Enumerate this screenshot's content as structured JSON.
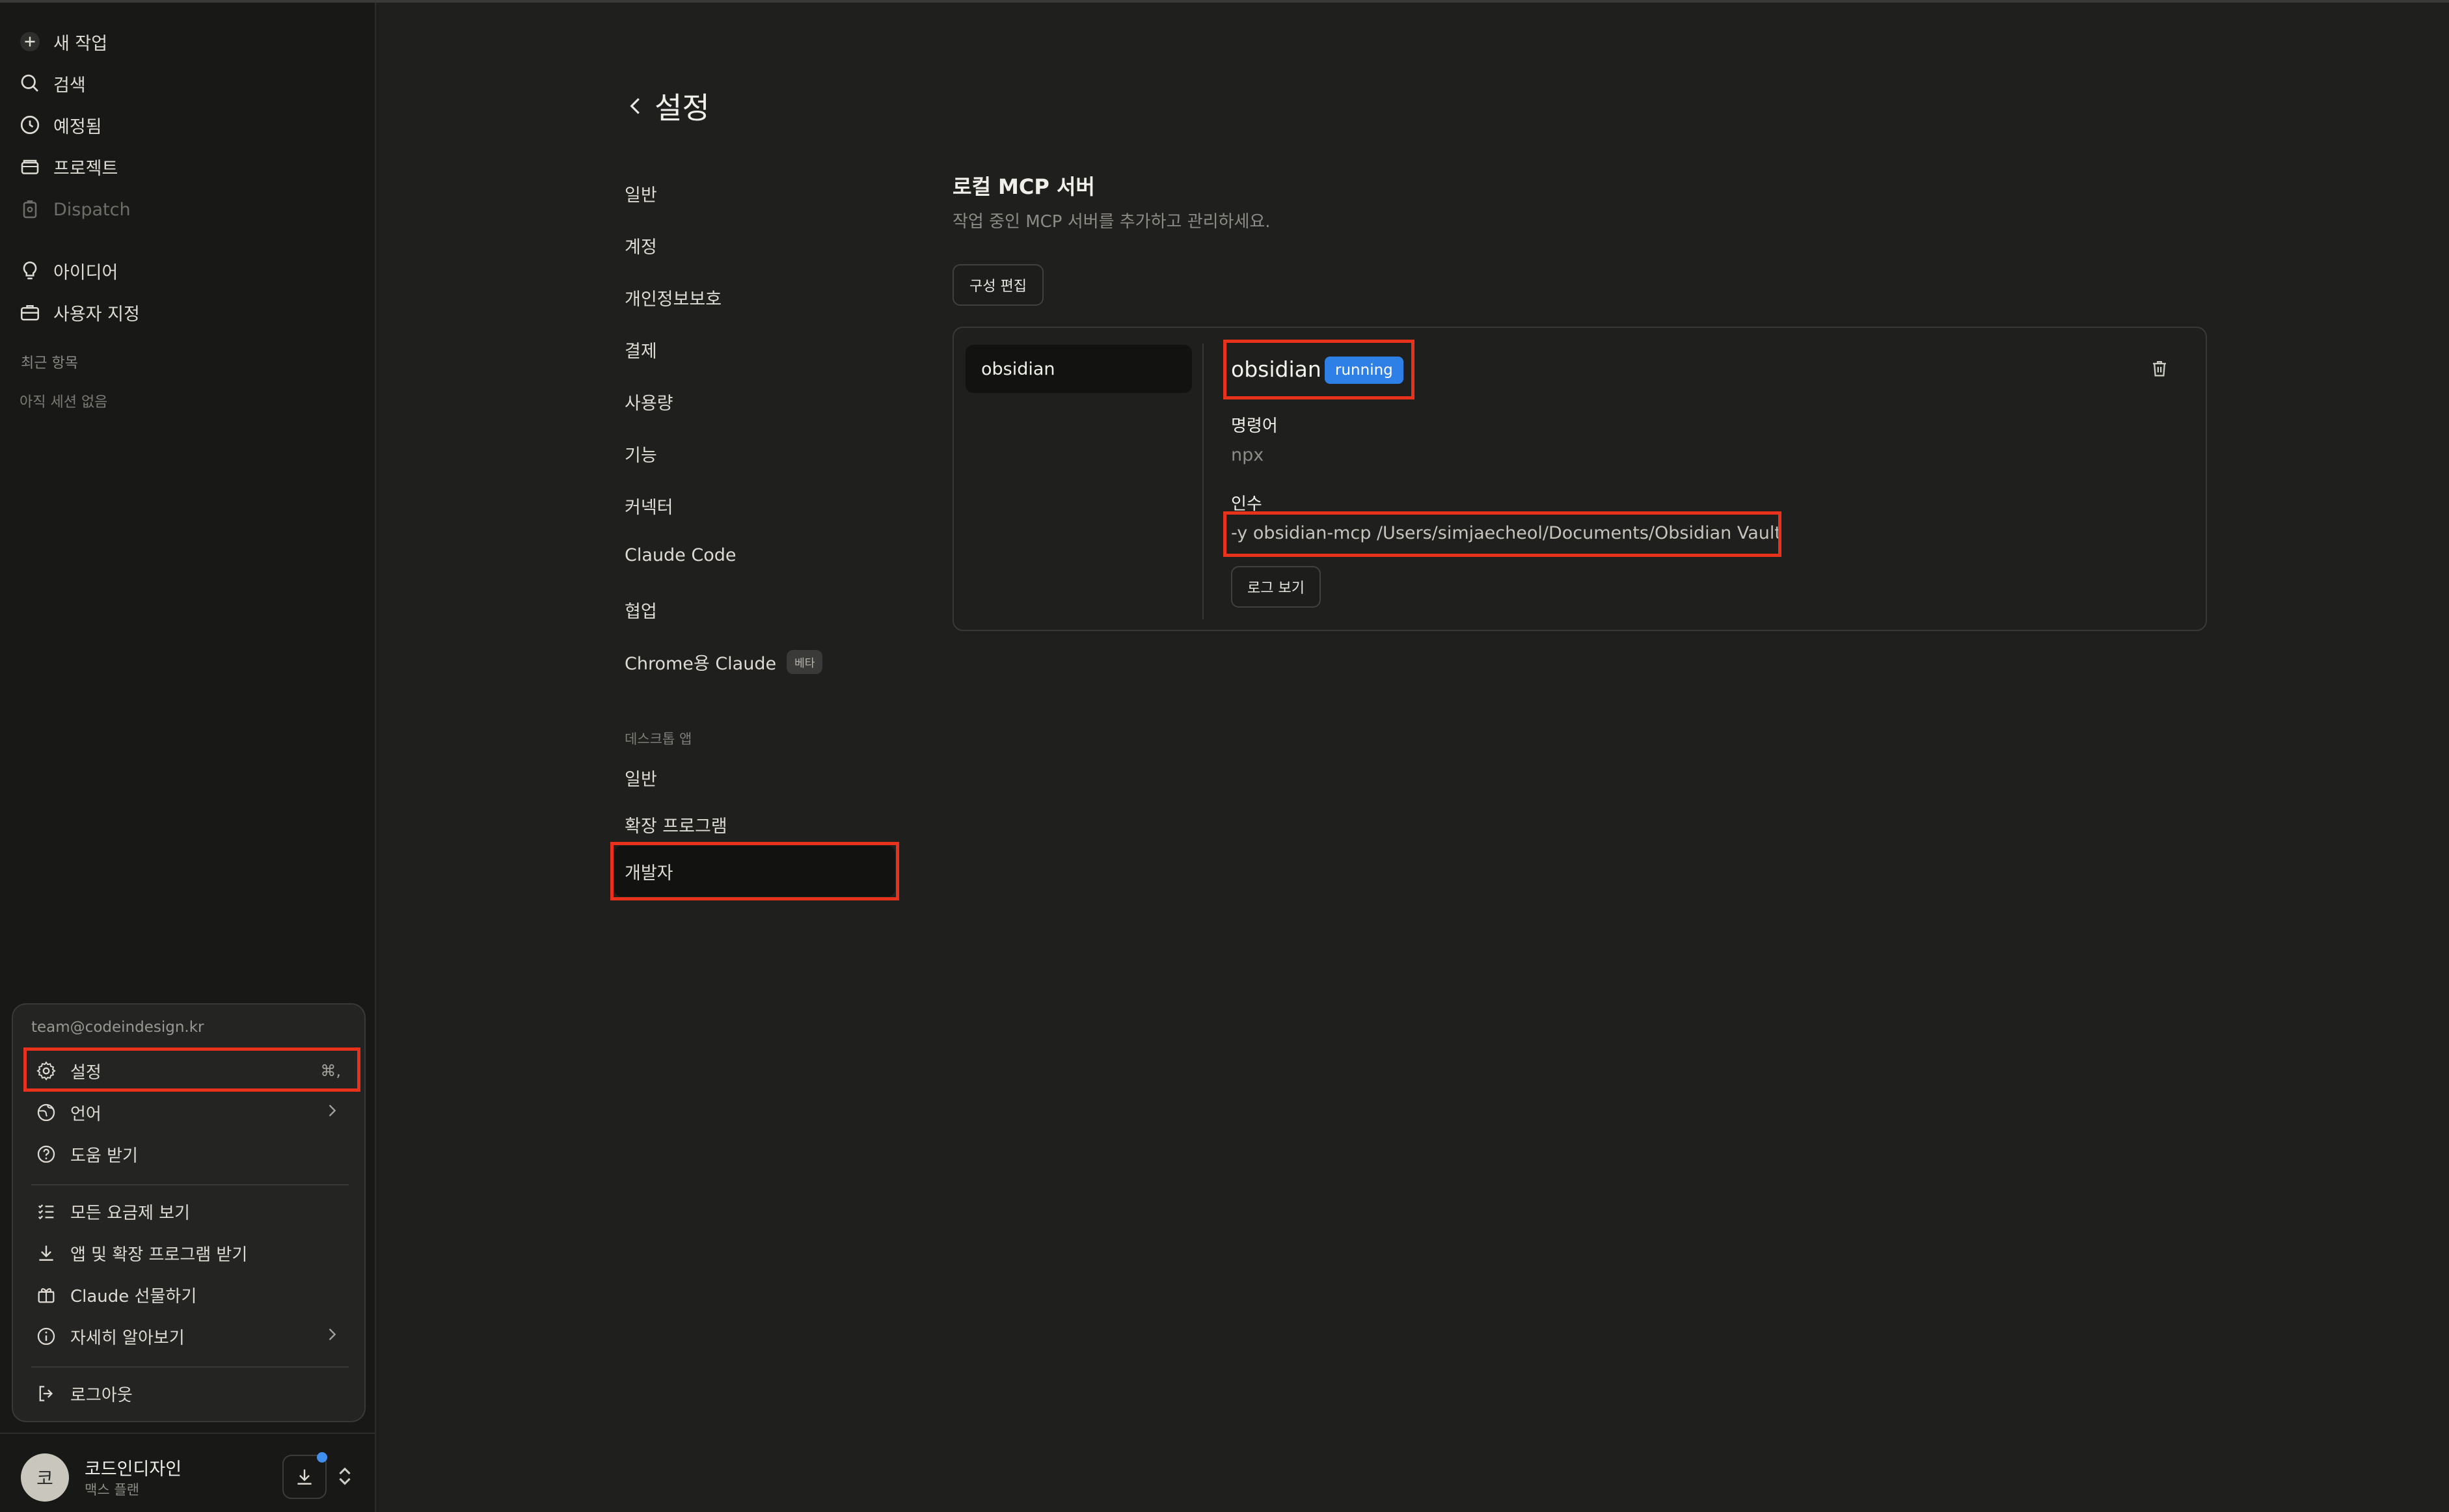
{
  "sidebar": {
    "nav": [
      {
        "label": "새 작업",
        "icon": "plus-icon"
      },
      {
        "label": "검색",
        "icon": "search-icon"
      },
      {
        "label": "예정됨",
        "icon": "clock-icon"
      },
      {
        "label": "프로젝트",
        "icon": "folder-icon"
      },
      {
        "label": "Dispatch",
        "icon": "dispatch-icon"
      },
      {
        "label": "아이디어",
        "icon": "lightbulb-icon"
      },
      {
        "label": "사용자 지정",
        "icon": "briefcase-icon"
      }
    ],
    "recent_label": "최근 항목",
    "recent_empty": "아직 세션 없음"
  },
  "account_menu": {
    "email": "team@codeindesign.kr",
    "items": [
      {
        "label": "설정",
        "icon": "gear-icon",
        "shortcut": "⌘,"
      },
      {
        "label": "언어",
        "icon": "globe-icon"
      },
      {
        "label": "도움 받기",
        "icon": "help-icon"
      },
      {
        "label": "모든 요금제 보기",
        "icon": "list-icon"
      },
      {
        "label": "앱 및 확장 프로그램 받기",
        "icon": "download-icon"
      },
      {
        "label": "Claude 선물하기",
        "icon": "gift-icon"
      },
      {
        "label": "자세히 알아보기",
        "icon": "info-icon"
      },
      {
        "label": "로그아웃",
        "icon": "logout-icon"
      }
    ]
  },
  "user": {
    "initial": "코",
    "name": "코드인디자인",
    "plan": "맥스 플랜"
  },
  "settings": {
    "title": "설정",
    "nav": [
      "일반",
      "계정",
      "개인정보보호",
      "결제",
      "사용량",
      "기능",
      "커넥터",
      "Claude Code",
      "협업",
      "Chrome용 Claude"
    ],
    "beta_badge": "베타",
    "desktop_group": "데스크톱 앱",
    "desktop_nav": [
      "일반",
      "확장 프로그램",
      "개발자"
    ]
  },
  "mcp": {
    "title": "로컬 MCP 서버",
    "description": "작업 중인 MCP 서버를 추가하고 관리하세요.",
    "edit_config": "구성 편집",
    "server": {
      "list_name": "obsidian",
      "name": "obsidian",
      "status": "running",
      "command_label": "명령어",
      "command": "npx",
      "args_label": "인수",
      "args": "-y obsidian-mcp /Users/simjaecheol/Documents/Obsidian Vault",
      "log_button": "로그 보기"
    }
  },
  "colors": {
    "background": "#1f1f1e",
    "sidebar": "#181817",
    "accent_running": "#2f80e6",
    "highlight": "#e8321c"
  }
}
